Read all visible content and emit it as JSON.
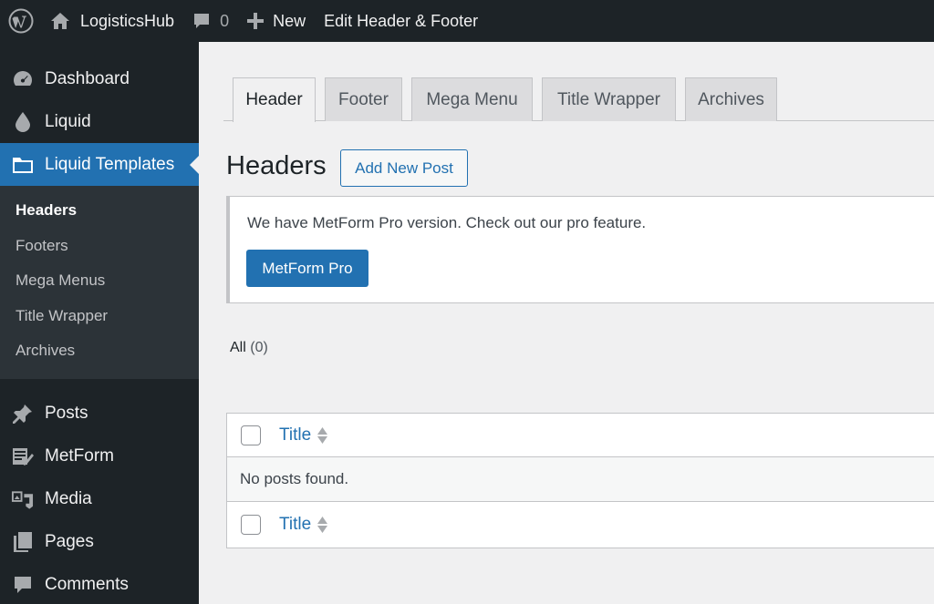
{
  "adminbar": {
    "site_name": "LogisticsHub",
    "comments_count": "0",
    "new_label": "New",
    "edit_label": "Edit Header & Footer"
  },
  "sidebar": {
    "items": [
      {
        "label": "Dashboard",
        "icon": "dashboard-icon"
      },
      {
        "label": "Liquid",
        "icon": "droplet-icon"
      },
      {
        "label": "Liquid Templates",
        "icon": "folder-icon"
      },
      {
        "label": "Posts",
        "icon": "pin-icon"
      },
      {
        "label": "MetForm",
        "icon": "form-icon"
      },
      {
        "label": "Media",
        "icon": "media-icon"
      },
      {
        "label": "Pages",
        "icon": "pages-icon"
      },
      {
        "label": "Comments",
        "icon": "comment-icon"
      }
    ],
    "submenu": [
      "Headers",
      "Footers",
      "Mega Menus",
      "Title Wrapper",
      "Archives"
    ]
  },
  "tabs": [
    "Header",
    "Footer",
    "Mega Menu",
    "Title Wrapper",
    "Archives"
  ],
  "page": {
    "title": "Headers",
    "add_new_label": "Add New Post"
  },
  "notice": {
    "text": "We have MetForm Pro version. Check out our pro feature.",
    "button": "MetForm Pro"
  },
  "filters": {
    "all_label": "All",
    "all_count": "(0)"
  },
  "table": {
    "column_title": "Title",
    "empty_text": "No posts found."
  },
  "colors": {
    "accent": "#2271b1",
    "adminbar_bg": "#1d2327",
    "submenu_bg": "#2c3338"
  }
}
